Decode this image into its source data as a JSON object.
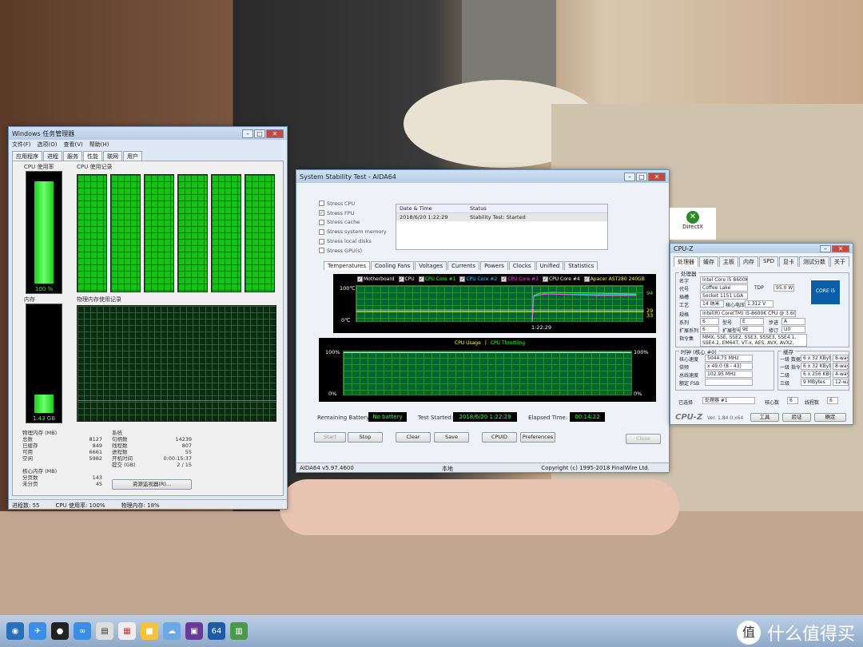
{
  "task_manager": {
    "title": "Windows 任务管理器",
    "menu": [
      "文件(F)",
      "选项(O)",
      "查看(V)",
      "帮助(H)"
    ],
    "tabs": [
      "应用程序",
      "进程",
      "服务",
      "性能",
      "联网",
      "用户"
    ],
    "cpu_usage_label": "CPU 使用率",
    "cpu_history_label": "CPU 使用记录",
    "cpu_usage_value": "100 %",
    "cpu_usage_percent": 100,
    "memory_label": "内存",
    "memory_history_label": "物理内存使用记录",
    "memory_value": "1.43 GB",
    "memory_percent": 18,
    "physical_memory": {
      "title": "物理内存 (MB)",
      "rows": [
        [
          "总数",
          "8127"
        ],
        [
          "已缓存",
          "849"
        ],
        [
          "可用",
          "6661"
        ],
        [
          "空闲",
          "5982"
        ]
      ]
    },
    "kernel_memory": {
      "title": "核心内存 (MB)",
      "rows": [
        [
          "分页数",
          "143"
        ],
        [
          "未分页",
          "45"
        ]
      ]
    },
    "system": {
      "title": "系统",
      "rows": [
        [
          "句柄数",
          "14239"
        ],
        [
          "线程数",
          "807"
        ],
        [
          "进程数",
          "55"
        ],
        [
          "开机时间",
          "0:00:15:37"
        ],
        [
          "提交 (GB)",
          "2 / 15"
        ]
      ]
    },
    "resource_monitor_button": "资源监视器(R)...",
    "statusbar": {
      "processes": "进程数: 55",
      "cpu": "CPU 使用率: 100%",
      "memory": "物理内存: 18%"
    }
  },
  "aida": {
    "title": "System Stability Test - AIDA64",
    "stress_options": [
      {
        "label": "Stress CPU",
        "checked": false
      },
      {
        "label": "Stress FPU",
        "checked": true
      },
      {
        "label": "Stress cache",
        "checked": false
      },
      {
        "label": "Stress system memory",
        "checked": false
      },
      {
        "label": "Stress local disks",
        "checked": false
      },
      {
        "label": "Stress GPU(s)",
        "checked": false
      }
    ],
    "log_headers": [
      "Date & Time",
      "Status"
    ],
    "log_rows": [
      [
        "2018/6/20 1:22:29",
        "Stability Test: Started"
      ]
    ],
    "tabs": [
      "Temperatures",
      "Cooling Fans",
      "Voltages",
      "Currents",
      "Powers",
      "Clocks",
      "Unified",
      "Statistics"
    ],
    "temp_legend": [
      {
        "label": "Motherboard",
        "color": "#ffffff"
      },
      {
        "label": "CPU",
        "color": "#ffffff"
      },
      {
        "label": "CPU Core #1",
        "color": "#33ff33"
      },
      {
        "label": "CPU Core #2",
        "color": "#33ccff"
      },
      {
        "label": "CPU Core #3",
        "color": "#ff44ff"
      },
      {
        "label": "CPU Core #4",
        "color": "#ffffff"
      },
      {
        "label": "Apacer AST280 240GB",
        "color": "#ffff33"
      }
    ],
    "temp_axis": {
      "top": "100℃",
      "bottom": "0℃",
      "time": "1:22:29"
    },
    "temp_right_labels": [
      "94",
      "29",
      "33"
    ],
    "usage_legend": [
      "CPU Usage",
      "CPU Throttling"
    ],
    "usage_axis": {
      "top_left": "100%",
      "bottom_left": "0%",
      "top_right": "100%",
      "bottom_right": "0%"
    },
    "remaining_battery_label": "Remaining Battery:",
    "remaining_battery": "No battery",
    "test_started_label": "Test Started:",
    "test_started": "2018/6/20 1:22:29",
    "elapsed_label": "Elapsed Time:",
    "elapsed": "00:14:22",
    "buttons": [
      "Start",
      "Stop",
      "Clear",
      "Save",
      "CPUID",
      "Preferences",
      "Close"
    ],
    "statusbar": {
      "app": "AIDA64 v5.97.4600",
      "local": "本地",
      "copyright": "Copyright (c) 1995-2018 FinalWire Ltd."
    },
    "side_item": "DirectX"
  },
  "cpuz": {
    "title": "CPU-Z",
    "tabs": [
      "处理器",
      "缓存",
      "主板",
      "内存",
      "SPD",
      "显卡",
      "测试分数",
      "关于"
    ],
    "processor_caption": "处理器",
    "fields": [
      [
        "名字",
        "Intel Core i5 8600K"
      ],
      [
        "代号",
        "Coffee Lake"
      ],
      [
        "TDP",
        "95.0 W"
      ],
      [
        "插槽",
        "Socket 1151 LGA"
      ],
      [
        "工艺",
        "14 纳米"
      ],
      [
        "核心电压",
        "1.312 V"
      ],
      [
        "规格",
        "Intel(R) Core(TM) i5-8600K CPU @ 3.60GHz"
      ],
      [
        "系列",
        "6"
      ],
      [
        "型号",
        "E"
      ],
      [
        "步进",
        "A"
      ],
      [
        "扩展系列",
        "6"
      ],
      [
        "扩展型号",
        "9E"
      ],
      [
        "修订",
        "U0"
      ],
      [
        "指令集",
        "MMX, SSE, SSE2, SSE3, SSSE3, SSE4.1, SSE4.2, EM64T, VT-x, AES, AVX, AVX2, FMA3, TSX"
      ]
    ],
    "clock_caption": "时钟 (核心 #0)",
    "clocks": [
      [
        "核心速度",
        "5044.75 MHz"
      ],
      [
        "倍频",
        "x 49.0 (8 - 43)"
      ],
      [
        "总线速度",
        "102.95 MHz"
      ],
      [
        "额定 FSB",
        ""
      ]
    ],
    "cache_caption": "缓存",
    "caches": [
      [
        "一级 数据",
        "6 x 32 KBytes",
        "8-way"
      ],
      [
        "一级 指令",
        "6 x 32 KBytes",
        "8-way"
      ],
      [
        "二级",
        "6 x 256 KBytes",
        "4-way"
      ],
      [
        "三级",
        "9 MBytes",
        "12-way"
      ]
    ],
    "selected_label": "已选择",
    "selected": "处理器 #1",
    "cores_label": "核心数",
    "cores": "6",
    "threads_label": "线程数",
    "threads": "6",
    "logo_text": "CPU-Z",
    "version": "Ver. 1.84.0.x64",
    "tools": "工具",
    "validate": "验证",
    "ok": "确定",
    "intel_badge": "CORE i5"
  },
  "taskbar": {
    "time_brand": "什么值得买",
    "logo": "值"
  }
}
